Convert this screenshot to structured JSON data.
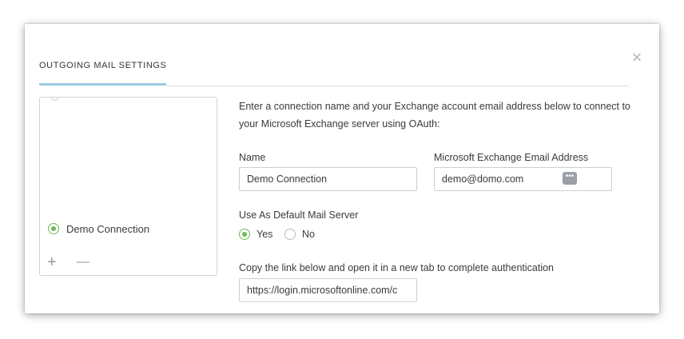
{
  "dialog": {
    "tab_title": "OUTGOING MAIL SETTINGS",
    "close_glyph": "×",
    "accent_color": "#99cce6"
  },
  "connections": {
    "items": [
      {
        "label": "Demo Connection",
        "selected": true
      }
    ],
    "add_glyph": "+",
    "remove_glyph": "—"
  },
  "form": {
    "intro": "Enter a connection name and your Exchange account email address below to connect to your Microsoft Exchange server using OAuth:",
    "name_label": "Name",
    "name_value": "Demo Connection",
    "email_label": "Microsoft Exchange Email Address",
    "email_value": "demo@domo.com",
    "email_icon": "more-dots-icon",
    "email_icon_glyph": "•••",
    "default_label": "Use As Default Mail Server",
    "default_options": [
      {
        "label": "Yes",
        "selected": true
      },
      {
        "label": "No",
        "selected": false
      }
    ],
    "link_label": "Copy the link below and open it in a new tab to complete authentication",
    "link_value": "https://login.microsoftonline.com/c"
  },
  "colors": {
    "radio_selected": "#6dbb56"
  }
}
